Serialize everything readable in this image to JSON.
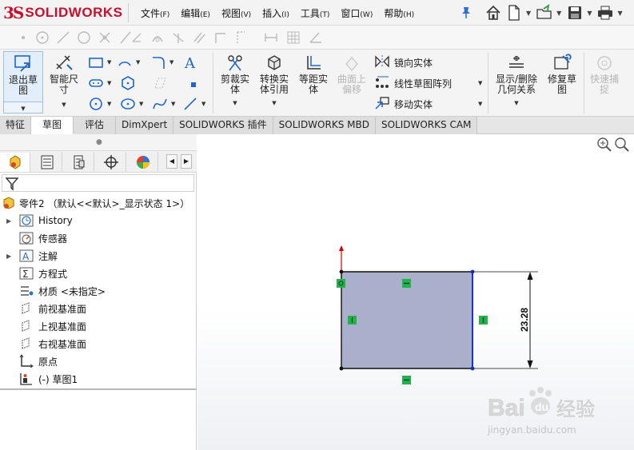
{
  "app": {
    "logo_prefix": "3S",
    "logo_name": "SOLIDWORKS"
  },
  "menu": [
    {
      "label": "文件",
      "key": "(F)"
    },
    {
      "label": "编辑",
      "key": "(E)"
    },
    {
      "label": "视图",
      "key": "(V)"
    },
    {
      "label": "插入",
      "key": "(I)"
    },
    {
      "label": "工具",
      "key": "(T)"
    },
    {
      "label": "窗口",
      "key": "(W)"
    },
    {
      "label": "帮助",
      "key": "(H)"
    }
  ],
  "quick_access": [
    "home-icon",
    "new-document-icon",
    "open-folder-icon",
    "save-icon",
    "print-icon"
  ],
  "commands": {
    "exit_sketch": "退出草图",
    "smart_dimension": "智能尺寸",
    "trim_entities": "剪裁实体",
    "convert_entities": "转换实体引用",
    "offset_entities": "等距实体",
    "offset_on_surface": "曲面上偏移",
    "mirror_entities": "镜向实体",
    "linear_pattern": "线性草图阵列",
    "move_entities": "移动实体",
    "display_delete_relations": "显示/删除几何关系",
    "repair_sketch": "修复草图",
    "quick_snaps": "快速捕捉"
  },
  "tabs": [
    {
      "label": "特征",
      "active": false
    },
    {
      "label": "草图",
      "active": true
    },
    {
      "label": "评估",
      "active": false
    },
    {
      "label": "DimXpert",
      "active": false
    },
    {
      "label": "SOLIDWORKS 插件",
      "active": false
    },
    {
      "label": "SOLIDWORKS MBD",
      "active": false
    },
    {
      "label": "SOLIDWORKS CAM",
      "active": false
    }
  ],
  "feature_tree": {
    "root": "零件2 （默认<<默认>_显示状态 1>）",
    "items": [
      {
        "label": "History",
        "icon": "history-icon",
        "expandable": true
      },
      {
        "label": "传感器",
        "icon": "sensor-icon",
        "expandable": false
      },
      {
        "label": "注解",
        "icon": "annotation-icon",
        "expandable": true
      },
      {
        "label": "方程式",
        "icon": "equation-icon",
        "expandable": false
      },
      {
        "label": "材质 <未指定>",
        "icon": "material-icon",
        "expandable": false
      },
      {
        "label": "前视基准面",
        "icon": "plane-icon",
        "expandable": false
      },
      {
        "label": "上视基准面",
        "icon": "plane-icon",
        "expandable": false
      },
      {
        "label": "右视基准面",
        "icon": "plane-icon",
        "expandable": false
      },
      {
        "label": "原点",
        "icon": "origin-icon",
        "expandable": false
      },
      {
        "label": "(-) 草图1",
        "icon": "sketch-icon",
        "expandable": false
      }
    ]
  },
  "sketch": {
    "dimension": "23.28",
    "fill_color": "#aab0cc",
    "selected_edge_color": "#1a2fd6",
    "relation_color": "#22b14c"
  },
  "watermark": {
    "brand": "Bai",
    "brand2": "经验",
    "url": "jingyan.baidu.com"
  }
}
